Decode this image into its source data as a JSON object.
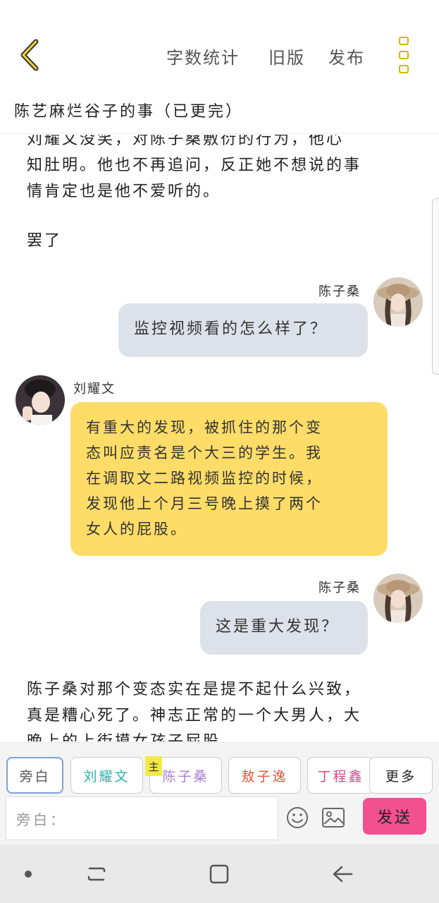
{
  "header": {
    "back_icon": "chevron-left-icon",
    "actions": [
      "字数统计",
      "旧版",
      "发布"
    ],
    "more_icon": "vertical-dots-icon",
    "story_title": "陈艺麻烂谷子的事（已更完）"
  },
  "content": {
    "narration_top": [
      "刘耀文没笑，对陈子桑敷衍的行为，他心",
      "知肚明。他也不再追问，反正她不想说的事",
      "情肯定也是他不爱听的。"
    ],
    "narration_short": "罢了",
    "msg1": {
      "speaker": "陈子桑",
      "text": "监控视频看的怎么样了？"
    },
    "msg2": {
      "speaker": "刘耀文",
      "lines": [
        "有重大的发现，被抓住的那个变",
        "态叫应责名是个大三的学生。我",
        "在调取文二路视频监控的时候，",
        "发现他上个月三号晚上摸了两个",
        "女人的屁股。"
      ]
    },
    "msg3": {
      "speaker": "陈子桑",
      "text": "这是重大发现？"
    },
    "narration_bottom": [
      "陈子桑对那个变态实在是提不起什么兴致，",
      "真是糟心死了。神志正常的一个大男人，大",
      "晚上的上街摸女孩子屁股"
    ]
  },
  "toolbar": {
    "characters": [
      {
        "label": "旁白",
        "color": "#555555"
      },
      {
        "label": "刘耀文",
        "color": "#2bb3a8"
      },
      {
        "label": "陈子桑",
        "color": "#a77fd0"
      },
      {
        "label": "敖子逸",
        "color": "#e0553e"
      },
      {
        "label": "丁程鑫",
        "color": "#d04a8c"
      },
      {
        "label": "更多",
        "color": "#555555"
      }
    ],
    "main_tag": "主",
    "input_placeholder": "旁白：",
    "emoji_icon": "smiley-icon",
    "image_icon": "image-icon",
    "send_label": "发送"
  },
  "system_nav": {
    "icons": [
      "dot-icon",
      "recent-apps-icon",
      "home-icon",
      "back-icon"
    ]
  }
}
